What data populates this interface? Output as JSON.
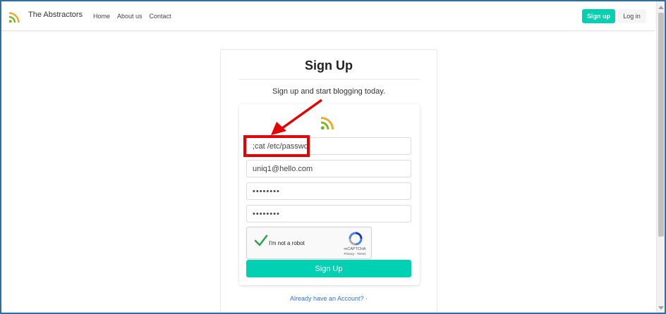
{
  "nav": {
    "brand": "The Abstractors",
    "links": [
      "Home",
      "About us",
      "Contact"
    ],
    "signup_label": "Sign up",
    "login_label": "Log in"
  },
  "card": {
    "title": "Sign Up",
    "subtitle": "Sign up and start blogging today."
  },
  "form": {
    "username_value": ";cat /etc/passwd;",
    "email_value": "uniq1@hello.com",
    "password_value": "••••••••",
    "confirm_password_value": "••••••••",
    "captcha": {
      "label": "I'm not a robot",
      "brand": "reCAPTCHA",
      "links": "Privacy - Terms"
    },
    "submit_label": "Sign Up",
    "already_account": "Already have an Account?  ·"
  },
  "colors": {
    "accent": "#00d1b2",
    "link": "#3273dc",
    "annotation": "#e60000",
    "logo_orange": "#f5a623",
    "logo_green": "#7ab317"
  },
  "icons": {
    "brand": "rss-feed-icon",
    "form_logo": "rss-feed-icon",
    "captcha_check": "checkmark-icon",
    "captcha_logo": "recaptcha-icon"
  }
}
